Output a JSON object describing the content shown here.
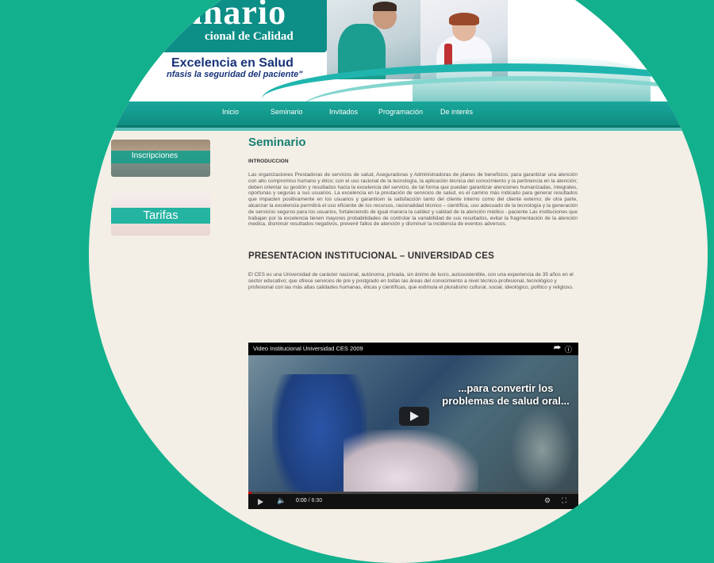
{
  "header": {
    "logo_text": "minario",
    "logo_sub": "cional de Calidad",
    "slogan": "Excelencia en Salud",
    "slogan_sub": "nfasis la seguridad del paciente\""
  },
  "nav": {
    "items": [
      {
        "label": "Inicio"
      },
      {
        "label": "Seminario"
      },
      {
        "label": "Invitados"
      },
      {
        "label": "Programación"
      },
      {
        "label": "De interés"
      }
    ]
  },
  "sidebar": {
    "inscripciones_label": "Inscripciones",
    "tarifas_label": "Tarifas"
  },
  "main": {
    "title": "Seminario",
    "intro_heading": "INTRODUCCION",
    "intro_text": "Las organizaciones Prestadoras de servicios de salud, Aseguradoras y Administradoras de planes de beneficios; para garantizar una atención con alto compromiso humano y ético; con el uso racional de la tecnología, la aplicación técnica del conocimiento y la pertinencia en la atención; deben orientar su gestión y resultados hacia la excelencia del servicio, de tal forma que puedan garantizar atenciones humanizadas, integrales, oportunas y seguras a sus usuarios. La excelencia en la prestación de servicios de salud, es el camino más indicado para generar resultados que impacten positivamente en los usuarios y garanticen la satisfacción tanto del cliente interno como del cliente externo; de otra parte, alcanzar la excelencia permitirá el uso eficiente de los recursos, racionalidad técnico – científica, uso adecuado de la tecnología y la generación de servicios seguros para los usuarios, fortaleciendo de igual manera la calidez y calidad de la atención médico - paciente Las instituciones que trabajan por la excelencia tienen mayores probabilidades de controlar la variabilidad de sus resultados, evitar la fragmentación de la atención medica, disminuir resultados negativos, prevenir fallos de atención y disminuir la incidencia de eventos adversos.",
    "section_heading": "PRESENTACION INSTITUCIONAL – UNIVERSIDAD CES",
    "section_text": "El CES es una Universidad de carácter nacional, autónoma, privada, sin ánimo de lucro, autosostenible, con una experiencia de 35 años en el sector educativo; que ofrece servicios de pre y postgrado en todas las áreas del conocimiento a nivel técnico-profesional, tecnológico y profesional con las más altas calidades humanas, éticas y científicas, que estimula el pluralismo cultural, social, ideológico, político y religioso."
  },
  "video": {
    "title": "Video Institucional Universidad CES 2009",
    "caption": "...para convertir los problemas de salud oral...",
    "current_time": "0:00",
    "duration": "/ 6:30",
    "progress_fraction": 0.01
  }
}
